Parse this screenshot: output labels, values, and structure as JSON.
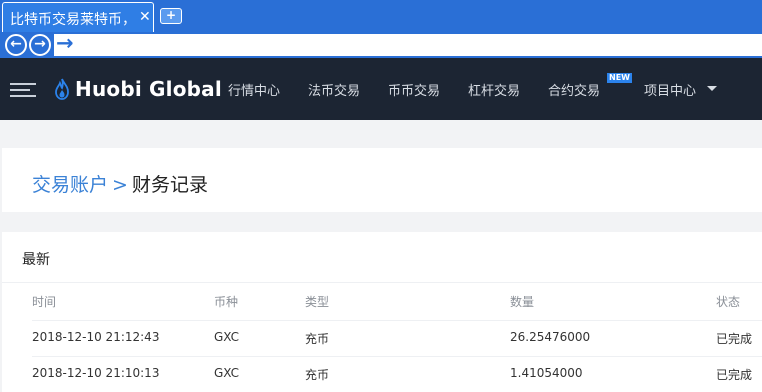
{
  "browser": {
    "tab_title": "比特币交易莱特币，",
    "tab_close": "✕",
    "new_tab": "+",
    "back": "←",
    "forward": "→",
    "go": "→"
  },
  "header": {
    "logo_text": "Huobi Global",
    "nav": [
      "行情中心",
      "法币交易",
      "币币交易",
      "杠杆交易",
      "合约交易",
      "项目中心"
    ],
    "new_badge": "NEW"
  },
  "breadcrumb": {
    "parent": "交易账户",
    "separator": ">",
    "current": "财务记录"
  },
  "records": {
    "title": "最新",
    "columns": [
      "时间",
      "币种",
      "类型",
      "数量",
      "状态"
    ],
    "rows": [
      [
        "2018-12-10 21:12:43",
        "GXC",
        "充币",
        "26.25476000",
        "已完成"
      ],
      [
        "2018-12-10 21:10:13",
        "GXC",
        "充币",
        "1.41054000",
        "已完成"
      ]
    ]
  },
  "colors": {
    "browser_blue": "#2a6fd6",
    "header_bg": "#1c2533",
    "link_blue": "#3b82d6",
    "badge_blue": "#2b83ec"
  }
}
